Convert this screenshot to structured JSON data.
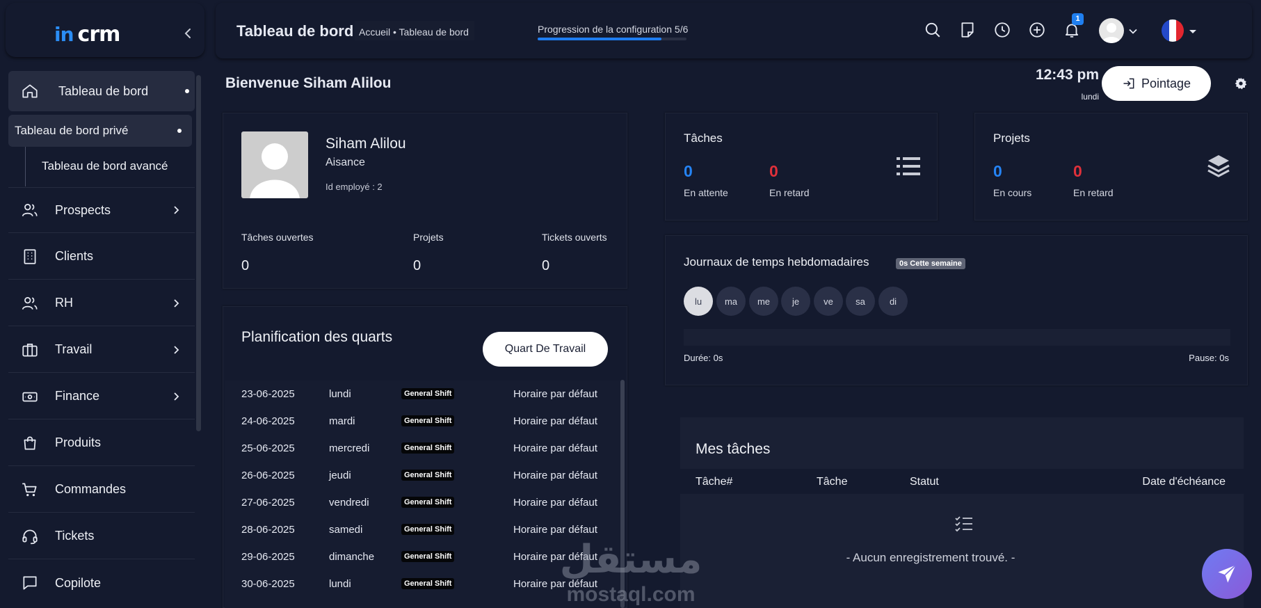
{
  "sidebar": {
    "items": [
      {
        "label": "Tableau de bord"
      },
      {
        "label": "Prospects"
      },
      {
        "label": "Clients"
      },
      {
        "label": "RH"
      },
      {
        "label": "Travail"
      },
      {
        "label": "Finance"
      },
      {
        "label": "Produits"
      },
      {
        "label": "Commandes"
      },
      {
        "label": "Tickets"
      },
      {
        "label": "Copilote"
      }
    ],
    "sub_items": [
      {
        "label": "Tableau de bord privé"
      },
      {
        "label": "Tableau de bord avancé"
      }
    ]
  },
  "header": {
    "title": "Tableau de bord",
    "breadcrumb": "Accueil • Tableau de bord",
    "progress_label": "Progression de la configuration",
    "progress_count": "5/6",
    "progress_fraction": 0.833,
    "notification_count": "1"
  },
  "welcome": {
    "text": "Bienvenue Siham Alilou",
    "time": "12:43 pm",
    "day": "lundi",
    "pointage_label": "Pointage"
  },
  "profile": {
    "name": "Siham Alilou",
    "company": "Aisance",
    "employee_id": "Id employé : 2",
    "stats": [
      {
        "label": "Tâches ouvertes",
        "value": "0"
      },
      {
        "label": "Projets",
        "value": "0"
      },
      {
        "label": "Tickets ouverts",
        "value": "0"
      }
    ]
  },
  "tasks_card": {
    "title": "Tâches",
    "pending_value": "0",
    "pending_label": "En attente",
    "late_value": "0",
    "late_label": "En retard"
  },
  "projects_card": {
    "title": "Projets",
    "ongoing_value": "0",
    "ongoing_label": "En cours",
    "late_value": "0",
    "late_label": "En retard"
  },
  "timelog": {
    "title": "Journaux de temps hebdomadaires",
    "badge": "0s Cette semaine",
    "days": [
      "lu",
      "ma",
      "me",
      "je",
      "ve",
      "sa",
      "di"
    ],
    "duration": "Durée: 0s",
    "pause": "Pause: 0s"
  },
  "shifts": {
    "title": "Planification des quarts",
    "button": "Quart De Travail",
    "rows": [
      {
        "date": "23-06-2025",
        "day": "lundi",
        "shift": "General Shift",
        "schedule": "Horaire par défaut"
      },
      {
        "date": "24-06-2025",
        "day": "mardi",
        "shift": "General Shift",
        "schedule": "Horaire par défaut"
      },
      {
        "date": "25-06-2025",
        "day": "mercredi",
        "shift": "General Shift",
        "schedule": "Horaire par défaut"
      },
      {
        "date": "26-06-2025",
        "day": "jeudi",
        "shift": "General Shift",
        "schedule": "Horaire par défaut"
      },
      {
        "date": "27-06-2025",
        "day": "vendredi",
        "shift": "General Shift",
        "schedule": "Horaire par défaut"
      },
      {
        "date": "28-06-2025",
        "day": "samedi",
        "shift": "General Shift",
        "schedule": "Horaire par défaut"
      },
      {
        "date": "29-06-2025",
        "day": "dimanche",
        "shift": "General Shift",
        "schedule": "Horaire par défaut"
      },
      {
        "date": "30-06-2025",
        "day": "lundi",
        "shift": "General Shift",
        "schedule": "Horaire par défaut"
      }
    ]
  },
  "my_tasks": {
    "title": "Mes tâches",
    "columns": [
      "Tâche#",
      "Tâche",
      "Statut",
      "Date d'échéance"
    ],
    "empty": "- Aucun enregistrement trouvé. -"
  },
  "branding": {
    "logo_in": "in",
    "logo_crm": "crm",
    "watermark_ar": "مستقل",
    "watermark_url": "mostaql.com"
  },
  "colors": {
    "background": "#141a2e",
    "accent_blue": "#2584f5",
    "alert_red": "#e0303a"
  }
}
